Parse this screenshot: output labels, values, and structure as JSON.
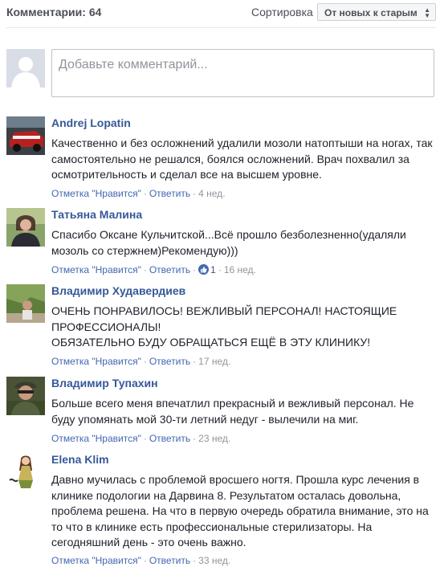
{
  "header": {
    "comments_count": "Комментарии: 64",
    "sort_label": "Сортировка",
    "sort_value": "От новых к старым"
  },
  "composer": {
    "placeholder": "Добавьте комментарий..."
  },
  "comments": [
    {
      "author": "Andrej Lopatin",
      "text": "Качественно и без осложнений удалили мозоли натоптыши на ногах, так самостоятельно не решался, боялся осложнений. Врач похвалил за осмотрительность и сделал все на высшем уровне.",
      "like_label": "Отметка \"Нравится\"",
      "reply_label": "Ответить",
      "time": "4 нед."
    },
    {
      "author": "Татьяна Малина",
      "text": "Спасибо Оксане Кульчитской...Всё прошло безболезненно(удаляли мозоль со стержнем)Рекомендую)))",
      "like_label": "Отметка \"Нравится\"",
      "reply_label": "Ответить",
      "reactions": "1",
      "time": "16 нед."
    },
    {
      "author": "Владимир Худавердиев",
      "text": "ОЧЕНЬ ПОНРАВИЛОСЬ! ВЕЖЛИВЫЙ ПЕРСОНАЛ! НАСТОЯЩИЕ ПРОФЕССИОНАЛЫ!\nОБЯЗАТЕЛЬНО БУДУ ОБРАЩАТЬСЯ ЕЩЁ В ЭТУ КЛИНИКУ!",
      "like_label": "Отметка \"Нравится\"",
      "reply_label": "Ответить",
      "time": "17 нед."
    },
    {
      "author": "Владимир Тупахин",
      "text": "Больше всего меня впечатлил прекрасный и вежливый персонал. Не буду упомянать мой 30-ти летний недуг - вылечили на миг.",
      "like_label": "Отметка \"Нравится\"",
      "reply_label": "Ответить",
      "time": "23 нед."
    },
    {
      "author": "Elena Klim",
      "text": "Давно мучилась с проблемой вросшего ногтя. Прошла курс лечения в клинике подологии на Дарвина 8. Результатом осталась довольна, проблема решена. На что в первую очередь обратила внимание, это на то что в клинике есть профессиональные стерилизаторы. На сегодняшний день - это очень важно.",
      "like_label": "Отметка \"Нравится\"",
      "reply_label": "Ответить",
      "time": "33 нед."
    }
  ],
  "colors": {
    "link": "#4267b2",
    "author": "#365899",
    "muted": "#90949c",
    "text": "#1d2129"
  }
}
